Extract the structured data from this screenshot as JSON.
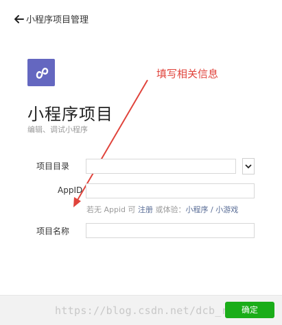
{
  "header": {
    "title": "小程序项目管理",
    "back_icon": "back-arrow-icon"
  },
  "app": {
    "logo_icon": "miniprogram-logo-icon",
    "logo_color": "#6467c0",
    "title": "小程序项目",
    "subtitle": "编辑、调试小程序"
  },
  "annotation": {
    "text": "填写相关信息",
    "color": "#e0433b"
  },
  "form": {
    "project_dir": {
      "label": "项目目录",
      "value": "",
      "dropdown_icon": "chevron-down-icon"
    },
    "appid": {
      "label": "AppID",
      "value": "",
      "hint": {
        "prefix": "若无 Appid 可 ",
        "register": "注册",
        "middle": " 或体验：",
        "miniprogram": "小程序",
        "sep": " / ",
        "minigame": "小游戏"
      }
    },
    "project_name": {
      "label": "项目名称",
      "value": ""
    }
  },
  "footer": {
    "confirm_label": "确定",
    "confirm_color": "#1aad19",
    "watermark": "https://blog.csdn.net/dcb_ripple"
  }
}
